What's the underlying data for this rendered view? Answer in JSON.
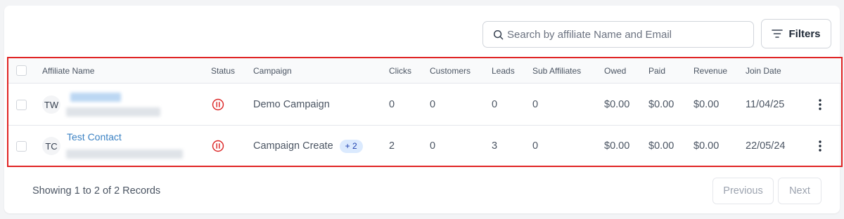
{
  "search": {
    "placeholder": "Search by affiliate Name and Email",
    "value": ""
  },
  "toolbar": {
    "filters_label": "Filters"
  },
  "table": {
    "columns": {
      "affiliate_name": "Affiliate Name",
      "status": "Status",
      "campaign": "Campaign",
      "clicks": "Clicks",
      "customers": "Customers",
      "leads": "Leads",
      "sub_affiliates": "Sub Affiliates",
      "owed": "Owed",
      "paid": "Paid",
      "revenue": "Revenue",
      "join_date": "Join Date"
    },
    "rows": [
      {
        "initials": "TW",
        "name": "",
        "campaign": "Demo Campaign",
        "campaign_extra": "",
        "clicks": "0",
        "customers": "0",
        "leads": "0",
        "sub_affiliates": "0",
        "owed": "$0.00",
        "paid": "$0.00",
        "revenue": "$0.00",
        "join_date": "11/04/25",
        "status_icon": "pause-circle-icon"
      },
      {
        "initials": "TC",
        "name": "Test Contact",
        "campaign": "Campaign Create",
        "campaign_extra": "+ 2",
        "clicks": "2",
        "customers": "0",
        "leads": "3",
        "sub_affiliates": "0",
        "owed": "$0.00",
        "paid": "$0.00",
        "revenue": "$0.00",
        "join_date": "22/05/24",
        "status_icon": "pause-circle-icon"
      }
    ]
  },
  "footer": {
    "summary": "Showing 1 to 2 of 2 Records",
    "previous_label": "Previous",
    "next_label": "Next"
  },
  "colors": {
    "highlight_border": "#e02424",
    "status_paused": "#dc2626",
    "link": "#3b82c4",
    "badge_bg": "#dbeafe"
  }
}
